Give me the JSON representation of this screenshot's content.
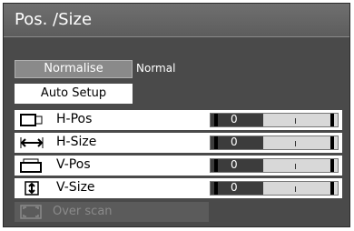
{
  "title": "Pos. /Size",
  "normalise": {
    "label": "Normalise",
    "value": "Normal"
  },
  "auto_setup": {
    "label": "Auto Setup"
  },
  "rows": [
    {
      "label": "H-Pos",
      "value": "0",
      "icon": "h-pos-icon"
    },
    {
      "label": "H-Size",
      "value": "0",
      "icon": "h-size-icon"
    },
    {
      "label": "V-Pos",
      "value": "0",
      "icon": "v-pos-icon"
    },
    {
      "label": "V-Size",
      "value": "0",
      "icon": "v-size-icon"
    }
  ],
  "over_scan": {
    "label": "Over scan",
    "icon": "over-scan-icon"
  }
}
